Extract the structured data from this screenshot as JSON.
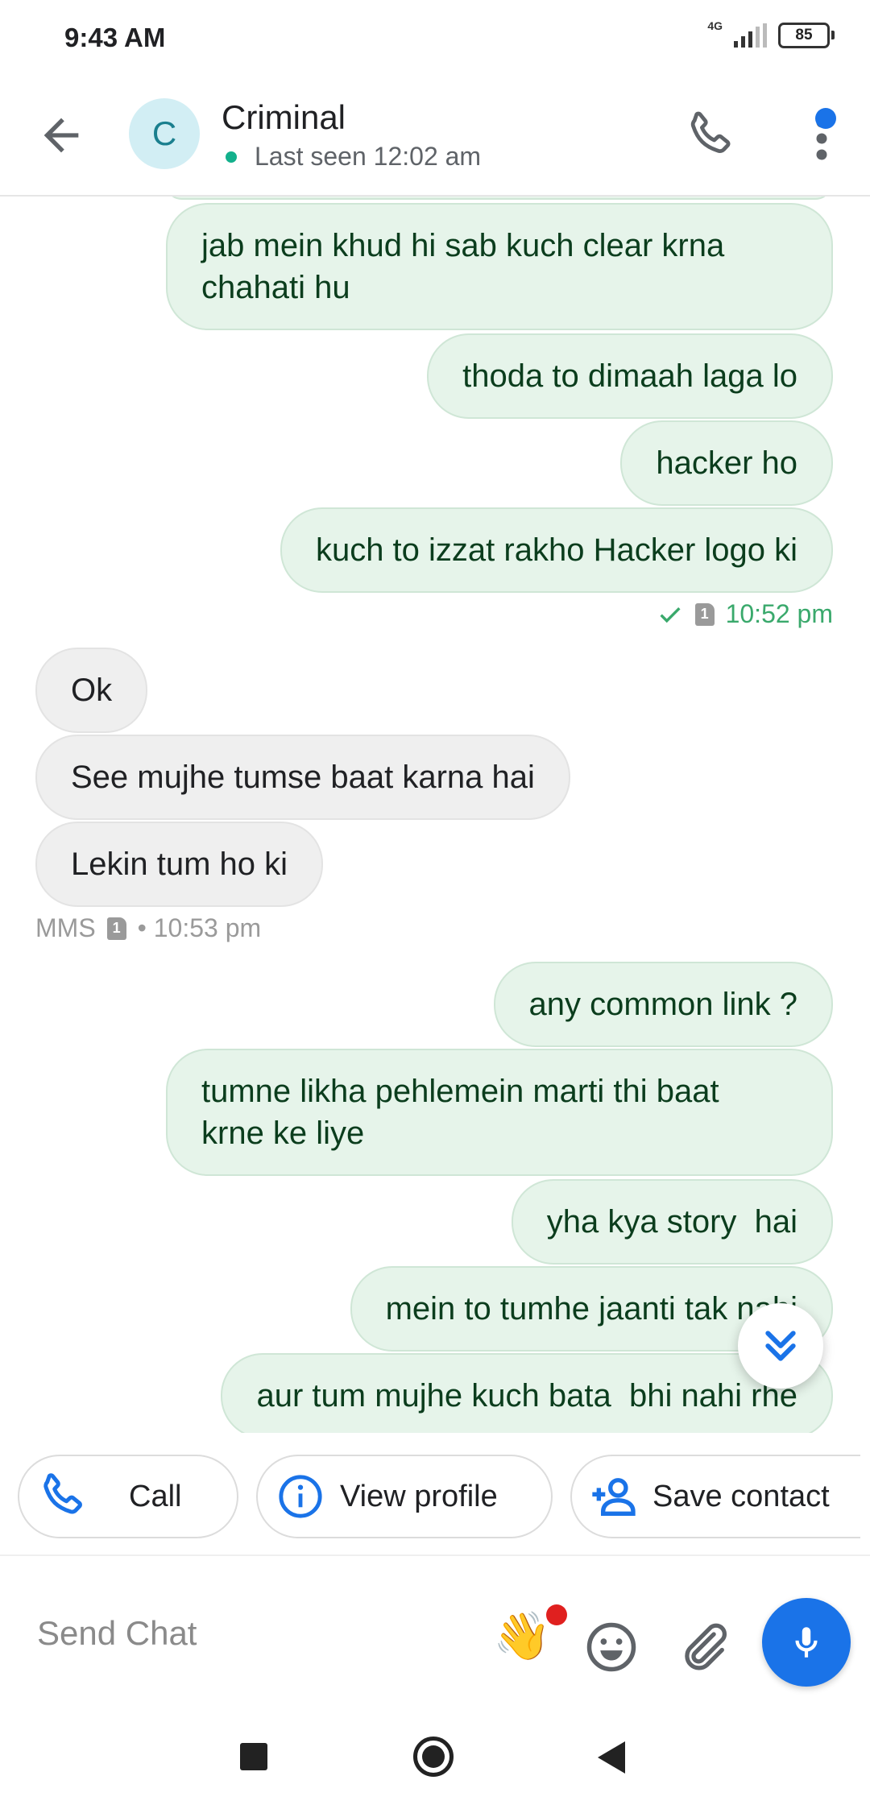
{
  "status_bar": {
    "time": "9:43 AM",
    "network": "4G",
    "battery": "85"
  },
  "header": {
    "avatar_letter": "C",
    "contact_name": "Criminal",
    "last_seen": "Last seen 12:02 am",
    "online_color": "#13b08c",
    "accent_color": "#1a73e8"
  },
  "messages": {
    "group1": [
      {
        "direction": "outgoing",
        "text_line1": "jab mein khud hi sab kuch clear krna",
        "text_line2": "chahati hu"
      },
      {
        "direction": "outgoing",
        "text": "thoda to dimaah laga lo"
      },
      {
        "direction": "outgoing",
        "text": "hacker ho"
      },
      {
        "direction": "outgoing",
        "text": "kuch to izzat rakho Hacker logo ki"
      }
    ],
    "group1_meta": {
      "sim": "1",
      "time": "10:52 pm",
      "status_icon": "check-icon"
    },
    "group2": [
      {
        "direction": "incoming",
        "text": "Ok"
      },
      {
        "direction": "incoming",
        "text": "See mujhe tumse baat karna hai"
      },
      {
        "direction": "incoming",
        "text": "Lekin tum ho ki"
      }
    ],
    "group2_meta": {
      "type": "MMS",
      "sim": "1",
      "time": "• 10:53 pm"
    },
    "group3": [
      {
        "direction": "outgoing",
        "text": "any common link ?"
      },
      {
        "direction": "outgoing",
        "text_line1": "tumne likha pehlemein marti thi baat",
        "text_line2": "krne ke liye"
      },
      {
        "direction": "outgoing",
        "text": "yha kya story  hai"
      },
      {
        "direction": "outgoing",
        "text": "mein to tumhe jaanti tak nahi"
      },
      {
        "direction": "outgoing",
        "text": "aur tum mujhe kuch bata  bhi nahi rhe"
      }
    ]
  },
  "actions": {
    "call": "Call",
    "view_profile": "View profile",
    "save_contact": "Save contact"
  },
  "composer": {
    "placeholder": "Send Chat",
    "wave_emoji": "👋",
    "mic_color": "#1a73e8"
  }
}
